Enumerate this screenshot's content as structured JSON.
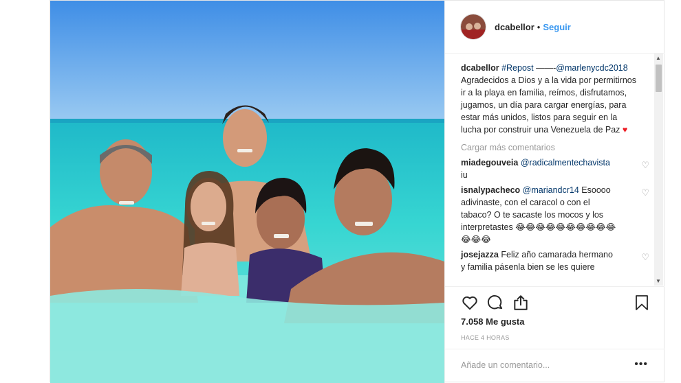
{
  "header": {
    "username": "dcabellor",
    "separator": "•",
    "follow_label": "Seguir"
  },
  "caption": {
    "username": "dcabellor",
    "hashtag": "#Repost",
    "dash": " ——-",
    "mention": "@marlenycdc2018",
    "text": "Agradecidos a Dios y a la vida por permitirnos ir a la playa en familia, reímos, disfrutamos, jugamos, un día para cargar energías, para estar más unidos, listos para seguir en la lucha por construir una Venezuela de Paz",
    "heart": "♥"
  },
  "load_more_label": "Cargar más comentarios",
  "comments": [
    {
      "user": "miadegouveia",
      "mention": "@radicalmentechavista",
      "text": " iu"
    },
    {
      "user": "isnalypacheco",
      "mention": "@mariandcr14",
      "text": " Esoooo adivinaste, con el caracol o con el tabaco? O te sacaste los mocos y los interpretastes 😂😂😂😂😂😂😂😂😂😂😂😂😂"
    },
    {
      "user": "josejazza",
      "mention": "",
      "text": " Feliz año camarada hermano y familia pásenla bien se les quiere"
    }
  ],
  "likes_label": "7.058 Me gusta",
  "timestamp": "HACE 4 HORAS",
  "add_comment_placeholder": "Añade un comentario...",
  "more_options": "•••",
  "icons": [
    "heart-outline-icon",
    "comment-icon",
    "share-icon",
    "bookmark-icon",
    "more-options-icon"
  ],
  "colors": {
    "accent": "#3897f0",
    "link": "#003569",
    "heart": "#ed1c24"
  }
}
